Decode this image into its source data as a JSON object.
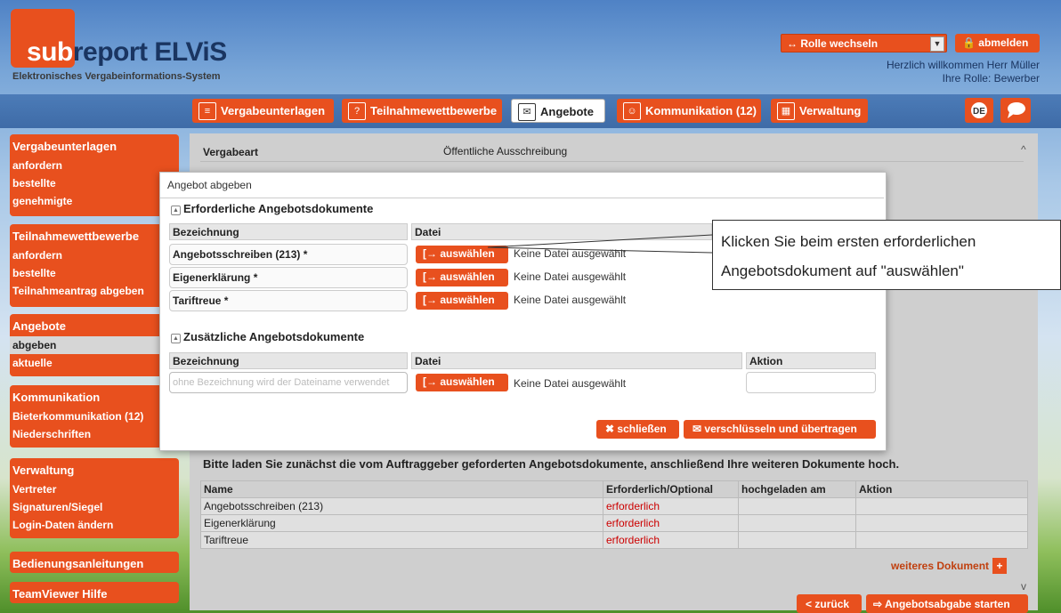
{
  "header": {
    "logo_sub": "sub",
    "logo_report": "report ELViS",
    "logo_tagline": "Elektronisches Vergabeinformations-System",
    "role_switch": "↔ Rolle wechseln",
    "logout": "abmelden",
    "welcome": "Herzlich willkommen Herr Müller",
    "role": "Ihre Rolle: Bewerber"
  },
  "nav": [
    {
      "label": "Vergabeunterlagen",
      "icon": "document-icon"
    },
    {
      "label": "Teilnahmewettbewerbe",
      "icon": "badge-icon"
    },
    {
      "label": "Angebote",
      "icon": "envelope-icon"
    },
    {
      "label": "Kommunikation (12)",
      "icon": "people-icon"
    },
    {
      "label": "Verwaltung",
      "icon": "grid-icon"
    }
  ],
  "lang": "DE",
  "sidebar": {
    "groups": [
      {
        "title": "Vergabeunterlagen",
        "items": [
          "anfordern",
          "bestellte",
          "genehmigte"
        ]
      },
      {
        "title": "Teilnahmewettbewerbe",
        "items": [
          "anfordern",
          "bestellte",
          "Teilnahmeantrag abgeben"
        ]
      },
      {
        "title": "Angebote",
        "items": [
          "abgeben",
          "aktuelle"
        ]
      },
      {
        "title": "Kommunikation",
        "items": [
          "Bieterkommunikation (12)",
          "Niederschriften"
        ]
      },
      {
        "title": "Verwaltung",
        "items": [
          "Vertreter",
          "Signaturen/Siegel",
          "Login-Daten ändern"
        ]
      },
      {
        "title": "Bedienungsanleitungen",
        "items": []
      },
      {
        "title": "TeamViewer Hilfe",
        "items": []
      }
    ]
  },
  "main": {
    "vergabeart_label": "Vergabeart",
    "vergabeart_value": "Öffentliche Ausschreibung",
    "intro": "Bitte laden Sie zunächst die vom Auftraggeber geforderten Angebotsdokumente, anschließend Ihre weiteren Dokumente hoch.",
    "table_headers": [
      "Name",
      "Erforderlich/Optional",
      "hochgeladen am",
      "Aktion"
    ],
    "table_rows": [
      [
        "Angebotsschreiben (213)",
        "erforderlich",
        "",
        ""
      ],
      [
        "Eigenerklärung",
        "erforderlich",
        "",
        ""
      ],
      [
        "Tariftreue",
        "erforderlich",
        "",
        ""
      ]
    ],
    "more_doc": "weiteres Dokument",
    "back": "zurück",
    "start": "Angebotsabgabe starten"
  },
  "modal": {
    "title": "Angebot abgeben",
    "required_section": "Erforderliche Angebotsdokumente",
    "col_name": "Bezeichnung",
    "col_file": "Datei",
    "required_docs": [
      "Angebotsschreiben (213) *",
      "Eigenerklärung *",
      "Tariftreue *"
    ],
    "upload_label": "auswählen",
    "no_file": "Keine Datei ausgewählt",
    "extra_section": "Zusätzliche Angebotsdokumente",
    "col_action": "Aktion",
    "name_placeholder": "ohne Bezeichnung wird der Dateiname verwendet",
    "close": "schließen",
    "submit": "verschlüsseln und übertragen"
  },
  "callout": {
    "line1": "Klicken Sie beim ersten erforderlichen",
    "line2": "Angebotsdokument  auf \"auswählen\""
  },
  "colors": {
    "accent": "#e8501e",
    "navy": "#1a3561",
    "nav_bar": "#3e6ba7",
    "required": "#cc0000"
  }
}
